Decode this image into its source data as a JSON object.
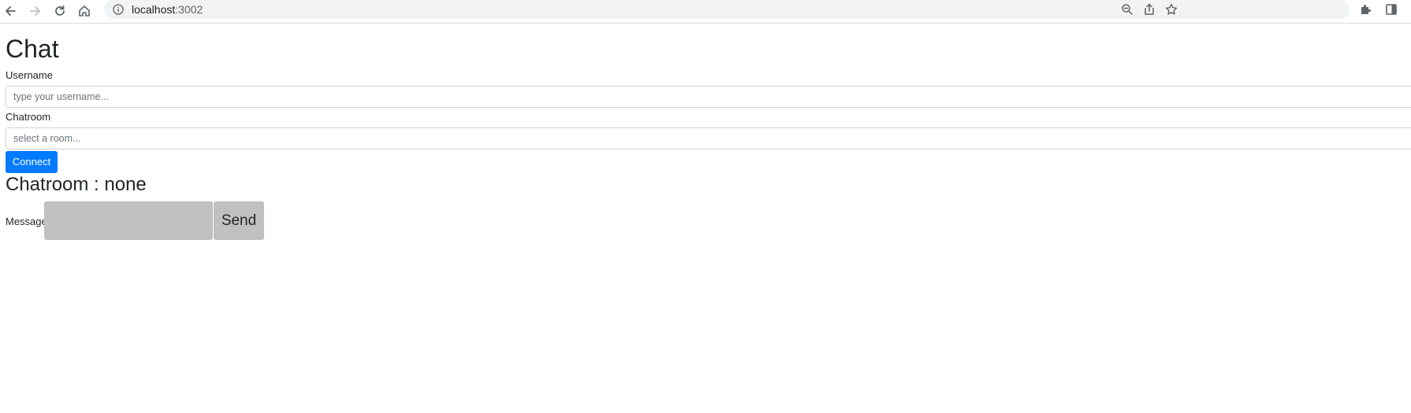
{
  "browser": {
    "url_host": "localhost",
    "url_port": ":3002"
  },
  "page": {
    "title": "Chat",
    "username": {
      "label": "Username",
      "placeholder": "type your username...",
      "value": ""
    },
    "chatroom": {
      "label": "Chatroom",
      "placeholder": "select a room...",
      "value": ""
    },
    "connect_label": "Connect",
    "chatroom_heading": "Chatroom : none",
    "message": {
      "label": "Message",
      "value": ""
    },
    "send_label": "Send"
  },
  "colors": {
    "primary_button": "#007bff",
    "disabled_gray": "#c0c0c0"
  },
  "icons": [
    "back-arrow-icon",
    "forward-arrow-icon",
    "reload-icon",
    "home-icon",
    "site-info-icon",
    "zoom-icon",
    "share-icon",
    "bookmark-star-icon",
    "extensions-puzzle-icon",
    "side-panel-icon"
  ]
}
